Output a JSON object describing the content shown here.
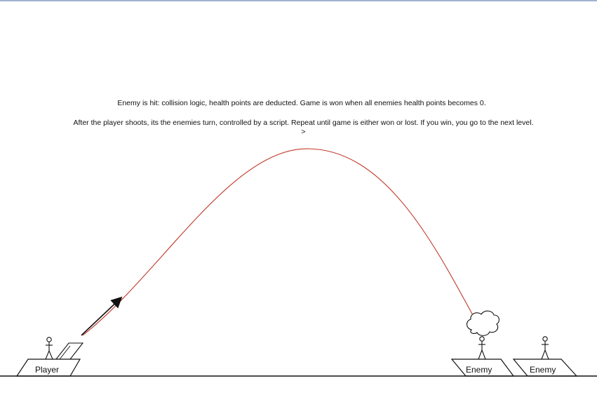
{
  "captions": {
    "hit_text": "Enemy is hit: collision logic, health points are deducted. Game is won when all enemies health points becomes 0.",
    "turn_text": "After the player shoots, its the enemies turn, controlled by a script. Repeat until game is either won or lost. If you win, you go to the next level. >"
  },
  "labels": {
    "player": "Player",
    "enemy_1": "Enemy",
    "enemy_2": "Enemy"
  },
  "colors": {
    "trajectory": "#c0392b",
    "ink": "#111111",
    "page_border": "#9fb4d0"
  },
  "icons": {
    "player_figure": "stick-figure-icon",
    "cannon": "cannon-icon",
    "aim_arrow": "aim-arrow-icon",
    "impact_cloud": "explosion-cloud-icon",
    "enemy_figure": "stick-figure-icon"
  }
}
